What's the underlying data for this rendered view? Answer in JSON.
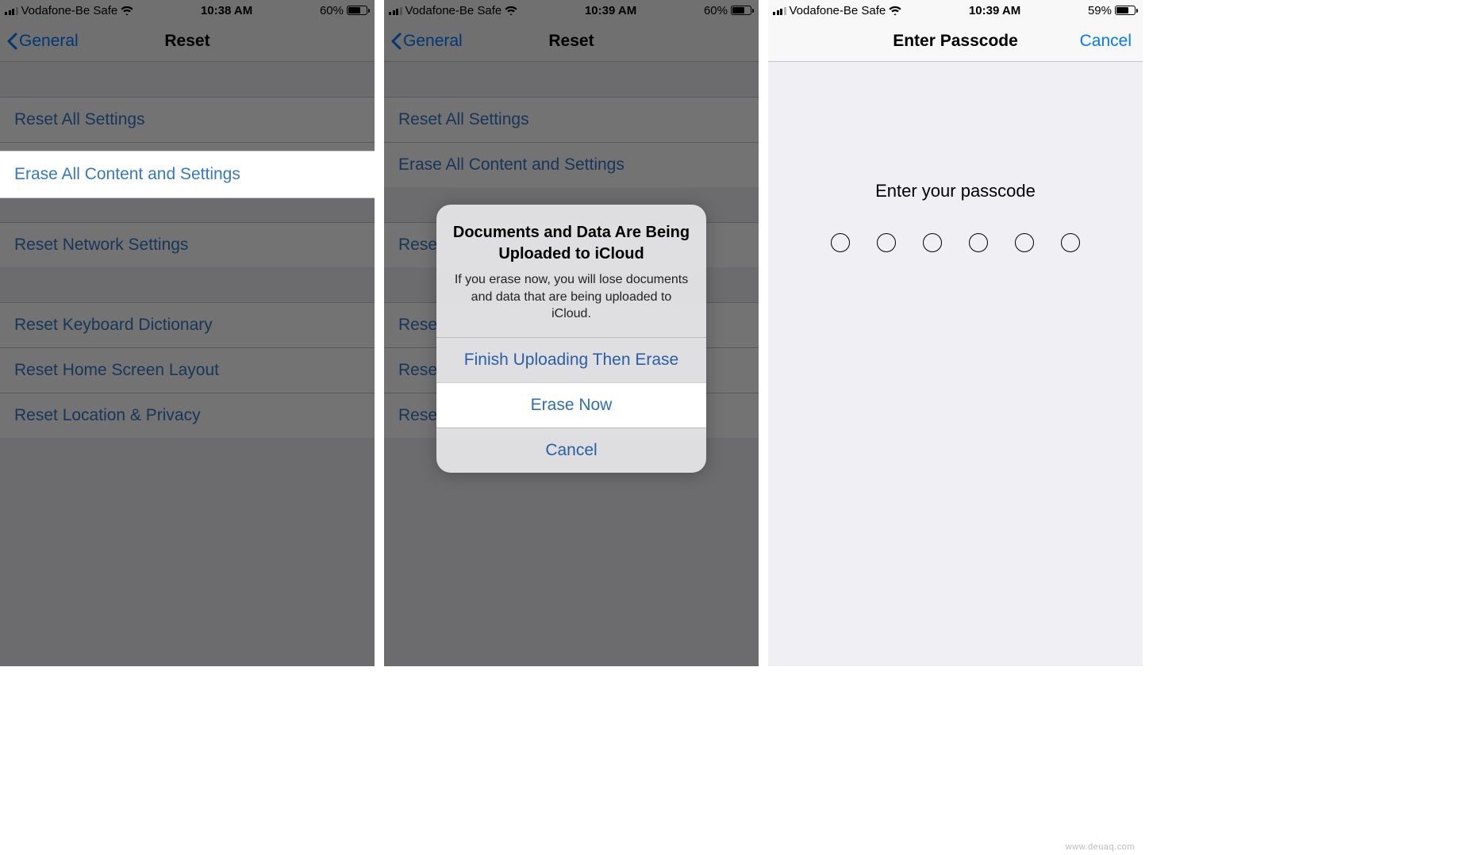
{
  "screens": [
    {
      "status": {
        "carrier": "Vodafone-Be Safe",
        "time": "10:38 AM",
        "battery_pct": "60%"
      },
      "nav": {
        "back": "General",
        "title": "Reset"
      },
      "cells": {
        "reset_all": "Reset All Settings",
        "erase_all": "Erase All Content and Settings",
        "reset_network": "Reset Network Settings",
        "reset_keyboard": "Reset Keyboard Dictionary",
        "reset_home": "Reset Home Screen Layout",
        "reset_location": "Reset Location & Privacy"
      }
    },
    {
      "status": {
        "carrier": "Vodafone-Be Safe",
        "time": "10:39 AM",
        "battery_pct": "60%"
      },
      "nav": {
        "back": "General",
        "title": "Reset"
      },
      "cells": {
        "reset_all": "Reset All Settings",
        "erase_all": "Erase All Content and Settings",
        "reset_network": "Rese",
        "reset_keyboard": "Rese",
        "reset_home": "Rese",
        "reset_location": "Rese"
      },
      "alert": {
        "title": "Documents and Data Are Being Uploaded to iCloud",
        "message": "If you erase now, you will lose documents and data that are being uploaded to iCloud.",
        "btn_finish": "Finish Uploading Then Erase",
        "btn_erase": "Erase Now",
        "btn_cancel": "Cancel"
      }
    },
    {
      "status": {
        "carrier": "Vodafone-Be Safe",
        "time": "10:39 AM",
        "battery_pct": "59%"
      },
      "nav": {
        "title": "Enter Passcode",
        "cancel": "Cancel"
      },
      "passcode": {
        "prompt": "Enter your passcode",
        "digits": 6
      }
    }
  ],
  "watermark": "www.deuaq.com",
  "battery_fill": {
    "s0": 15,
    "s1": 15,
    "s2": 15
  }
}
